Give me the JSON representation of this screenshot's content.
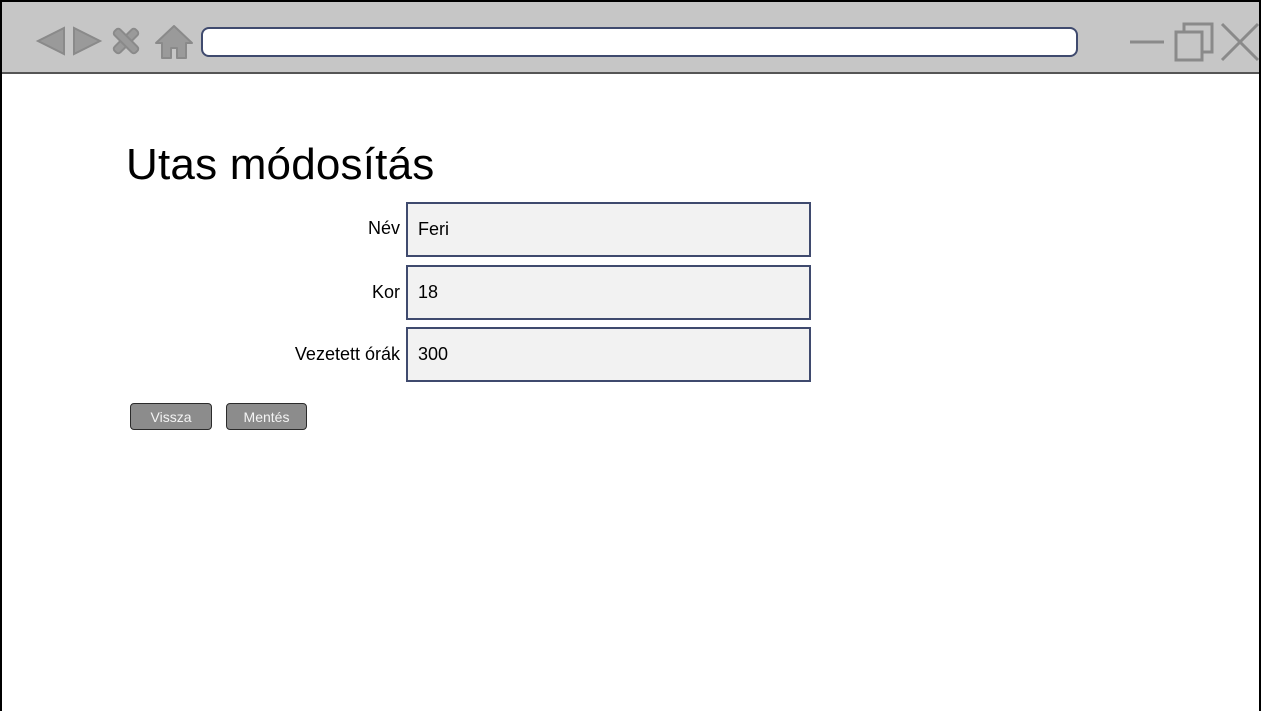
{
  "browser": {
    "address_value": "",
    "icons": [
      "back-arrow-icon",
      "forward-arrow-icon",
      "stop-icon",
      "home-icon",
      "minimize-icon",
      "restore-icon",
      "close-icon"
    ]
  },
  "page": {
    "title": "Utas módosítás"
  },
  "form": {
    "fields": [
      {
        "label": "Név",
        "value": "Feri"
      },
      {
        "label": "Kor",
        "value": "18"
      },
      {
        "label": "Vezetett órák",
        "value": "300"
      }
    ]
  },
  "buttons": {
    "back_label": "Vissza",
    "save_label": "Mentés"
  },
  "colors": {
    "toolbar": "#c6c6c6",
    "input_fill": "#f2f2f2",
    "input_border": "#3f4a6e",
    "button_fill": "#8c8c8c"
  }
}
